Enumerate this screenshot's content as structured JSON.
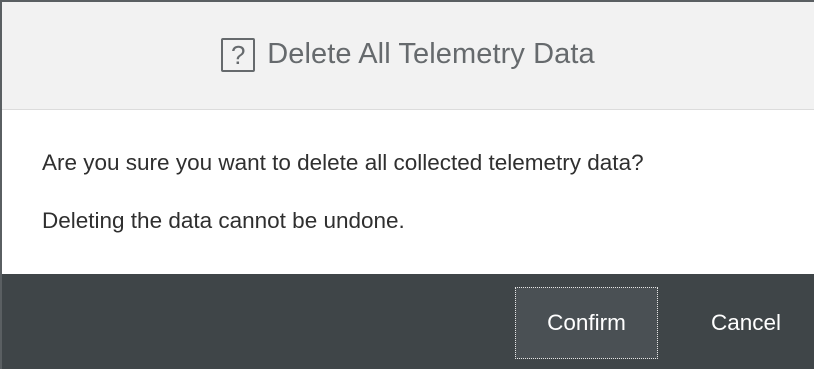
{
  "dialog": {
    "icon": "help-icon",
    "icon_glyph": "?",
    "title": "Delete All Telemetry Data",
    "message_1": "Are you sure you want to delete all collected telemetry data?",
    "message_2": "Deleting the data cannot be undone.",
    "confirm_label": "Confirm",
    "cancel_label": "Cancel"
  },
  "colors": {
    "header_bg": "#f2f2f2",
    "footer_bg": "#3f4548",
    "title_text": "#666a6d",
    "body_text": "#2f2f2f",
    "button_text": "#ffffff"
  }
}
